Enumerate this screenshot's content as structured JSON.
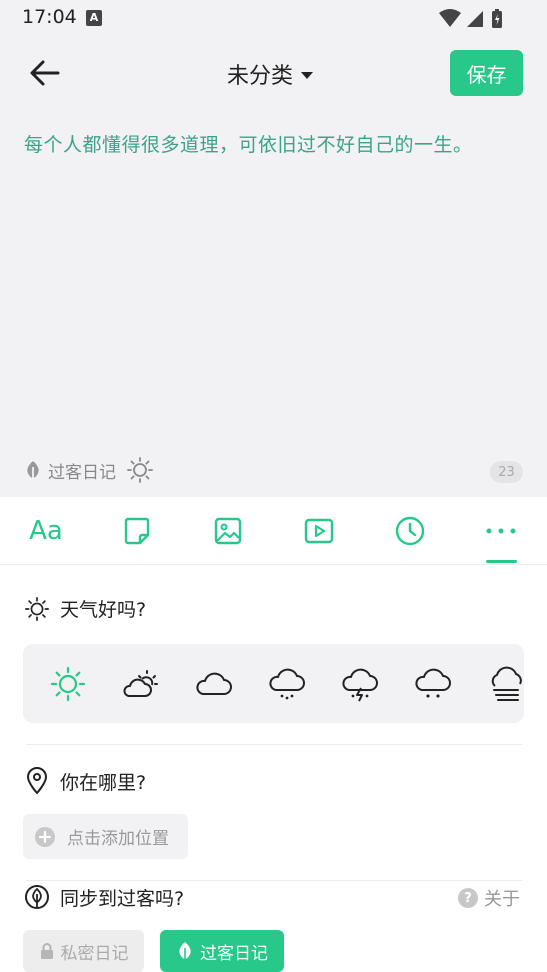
{
  "status": {
    "time": "17:04",
    "notif_icon": "A"
  },
  "header": {
    "category": "未分类",
    "save_label": "保存"
  },
  "editor": {
    "text": "每个人都懂得很多道理，可依旧过不好自己的一生。",
    "journal_label": "过客日记",
    "char_count": "23"
  },
  "toolbar": {
    "font_label": "Aa",
    "active_tab": "more"
  },
  "weather": {
    "title": "天气好吗?",
    "selected": "sunny",
    "options": [
      "sunny",
      "partly-cloudy",
      "cloudy",
      "rain",
      "thunderstorm",
      "snow",
      "fog"
    ]
  },
  "location": {
    "title": "你在哪里?",
    "add_label": "点击添加位置"
  },
  "sync": {
    "title": "同步到过客吗?",
    "about_label": "关于",
    "private_label": "私密日记",
    "public_label": "过客日记"
  },
  "colors": {
    "accent": "#27c88a",
    "text_green": "#3aa488"
  }
}
